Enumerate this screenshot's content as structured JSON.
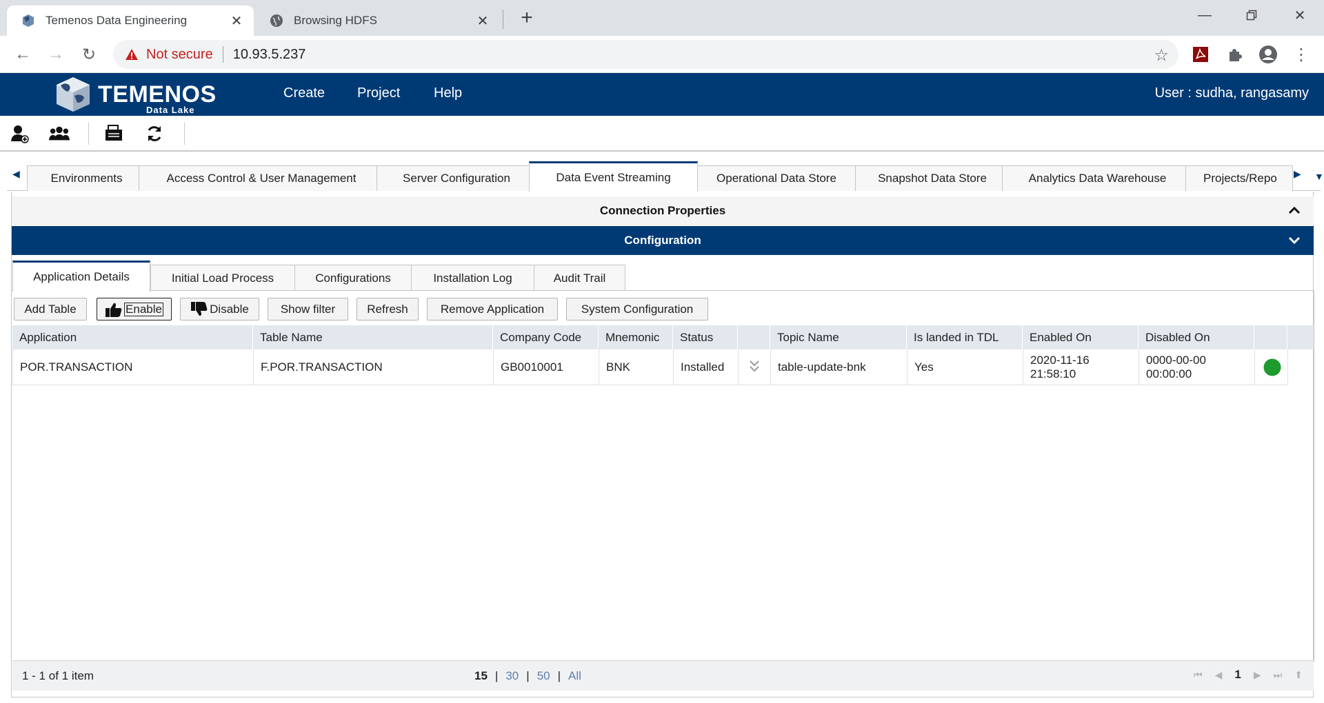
{
  "browser": {
    "tabs": [
      {
        "title": "Temenos Data Engineering",
        "active": true
      },
      {
        "title": "Browsing HDFS",
        "active": false
      }
    ],
    "address": {
      "security": "Not secure",
      "url": "10.93.5.237"
    }
  },
  "app": {
    "logo_text": "TEMENOS",
    "logo_subtext": "Data Lake",
    "menu": [
      "Create",
      "Project",
      "Help"
    ],
    "user": "User : sudha, rangasamy"
  },
  "main_tabs": [
    "Environments",
    "Access Control & User Management",
    "Server Configuration",
    "Data Event Streaming",
    "Operational Data Store",
    "Snapshot Data Store",
    "Analytics Data Warehouse",
    "Projects/Repo"
  ],
  "active_main_tab": "Data Event Streaming",
  "sections": {
    "connection": "Connection Properties",
    "configuration": "Configuration"
  },
  "sub_tabs": [
    "Application Details",
    "Initial Load Process",
    "Configurations",
    "Installation Log",
    "Audit Trail"
  ],
  "actions": {
    "add_table": "Add Table",
    "enable": "Enable",
    "disable": "Disable",
    "show_filter": "Show filter",
    "refresh": "Refresh",
    "remove_application": "Remove Application",
    "system_configuration": "System Configuration"
  },
  "grid": {
    "headers": [
      "Application",
      "Table Name",
      "Company Code",
      "Mnemonic",
      "Status",
      "",
      "Topic Name",
      "Is landed in TDL",
      "Enabled On",
      "Disabled On",
      ""
    ],
    "rows": [
      {
        "application": "POR.TRANSACTION",
        "table_name": "F.POR.TRANSACTION",
        "company_code": "GB0010001",
        "mnemonic": "BNK",
        "status": "Installed",
        "topic_name": "table-update-bnk",
        "landed": "Yes",
        "enabled_on_date": "2020-11-16",
        "enabled_on_time": "21:58:10",
        "disabled_on_date": "0000-00-00",
        "disabled_on_time": "00:00:00",
        "indicator_color": "#1e9b2e"
      }
    ],
    "footer": {
      "info": "1 - 1 of 1 item",
      "page_sizes": [
        "15",
        "30",
        "50",
        "All"
      ],
      "current_page": "1"
    }
  },
  "colors": {
    "brand": "#003a75",
    "status_green": "#1e9b2e",
    "warning_red": "#c5221f"
  }
}
